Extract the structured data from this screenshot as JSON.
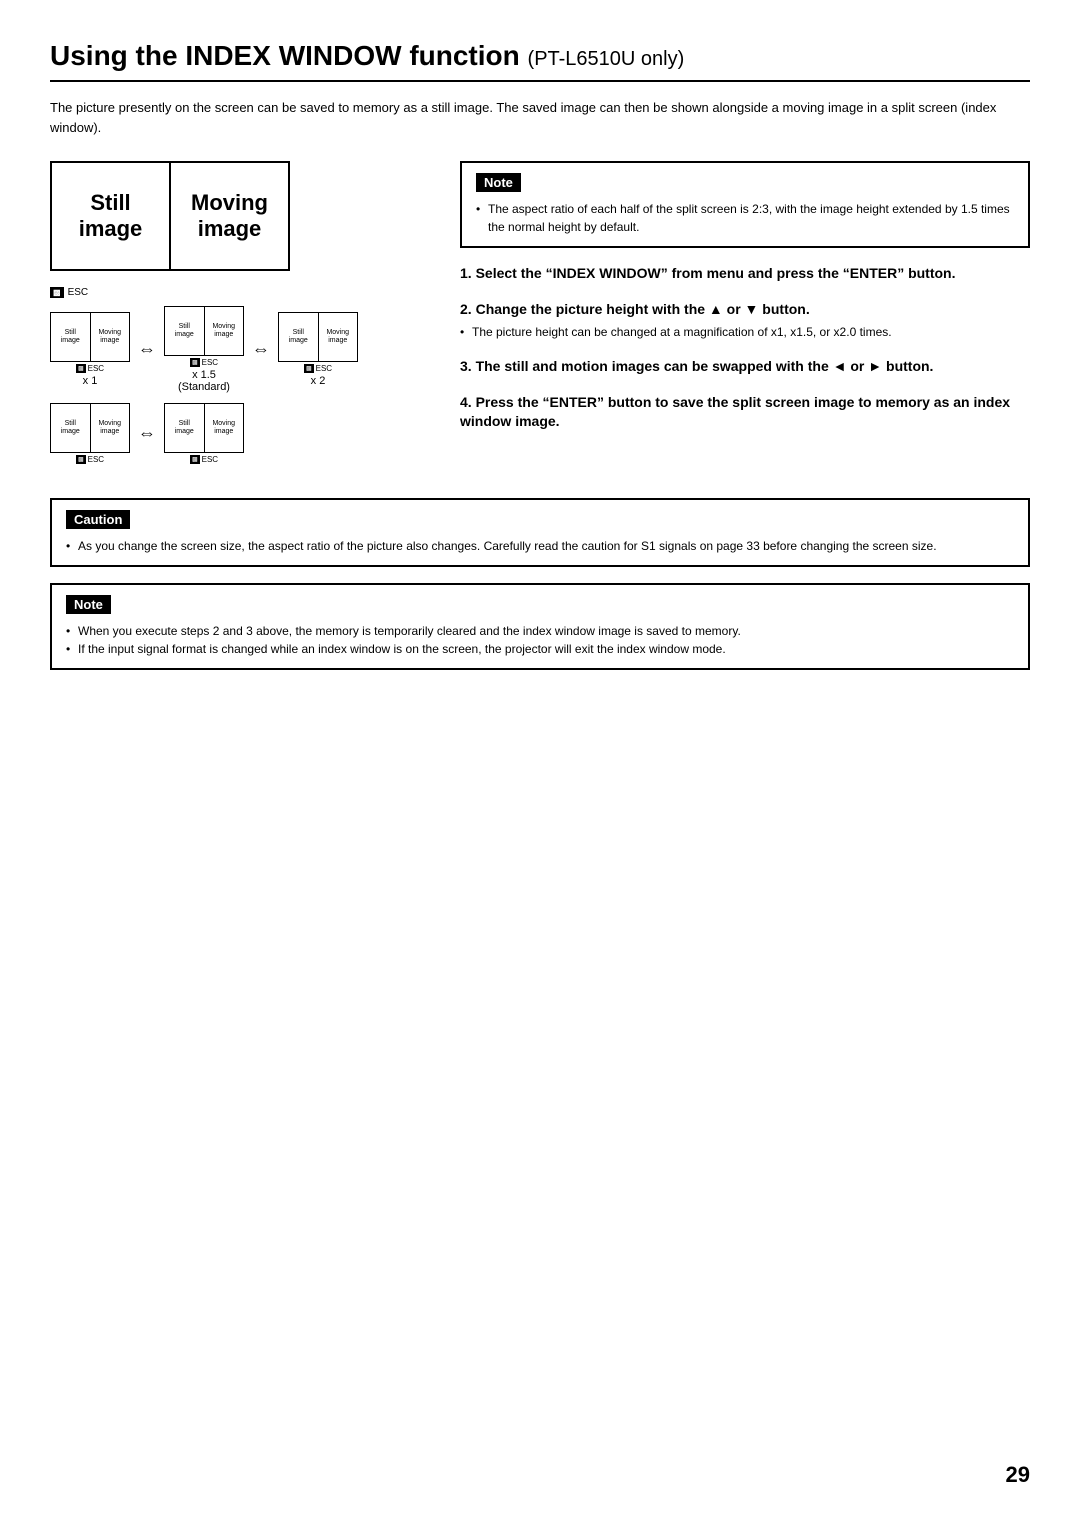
{
  "page": {
    "title": "Using the INDEX WINDOW function",
    "title_suffix": "(PT-L6510U only)",
    "page_number": "29"
  },
  "intro": {
    "text": "The picture presently on the screen can be saved to memory as a still image. The saved image can then be shown alongside a moving image in a split screen (index window)."
  },
  "big_diagram": {
    "left_label_line1": "Still",
    "left_label_line2": "image",
    "right_label_line1": "Moving",
    "right_label_line2": "image",
    "esc_text": "ESC"
  },
  "note_top": {
    "header": "Note",
    "items": [
      "The aspect ratio of each half of the split screen is 2:3, with the image height extended by 1.5 times the normal height by default."
    ]
  },
  "small_diagrams": {
    "row1": [
      {
        "left1": "Still",
        "left2": "image",
        "right1": "Moving",
        "right2": "image",
        "label": "x 1"
      },
      {
        "arrow": "⇔"
      },
      {
        "left1": "Still",
        "left2": "image",
        "right1": "Moving",
        "right2": "image",
        "label": "x 1.5\n(Standard)"
      },
      {
        "arrow": "⇔"
      },
      {
        "left1": "Still",
        "left2": "image",
        "right1": "Moving",
        "right2": "image",
        "label": "x 2"
      }
    ],
    "row2": [
      {
        "left1": "Still",
        "left2": "image",
        "right1": "Moving",
        "right2": "image",
        "label": ""
      },
      {
        "arrow": "⇔"
      },
      {
        "left1": "Still",
        "left2": "image",
        "right1": "Moving",
        "right2": "image",
        "label": ""
      }
    ]
  },
  "steps": [
    {
      "number": "1",
      "text": "Select the “INDEX WINDOW” from menu and press the “ENTER” button.",
      "subitems": []
    },
    {
      "number": "2",
      "text": "Change the picture height with the ▲ or ▼ button.",
      "subitems": [
        "The picture height can be changed at a magnification of x1, x1.5, or x2.0 times."
      ]
    },
    {
      "number": "3",
      "text": "The still and motion images can be swapped with the ◄ or ► button.",
      "subitems": []
    },
    {
      "number": "4",
      "text": "Press the “ENTER” button to save the split screen image to memory as an index window image.",
      "subitems": []
    }
  ],
  "caution": {
    "header": "Caution",
    "items": [
      "As you change the screen size, the aspect ratio of the picture also changes. Carefully read the caution for S1 signals on page 33 before changing the screen size."
    ]
  },
  "note_bottom": {
    "header": "Note",
    "items": [
      "When you execute steps 2 and 3 above, the memory is temporarily cleared and the index window image is saved to memory.",
      "If the input signal format is changed while an index window is on the screen, the projector will exit the index window mode."
    ]
  }
}
